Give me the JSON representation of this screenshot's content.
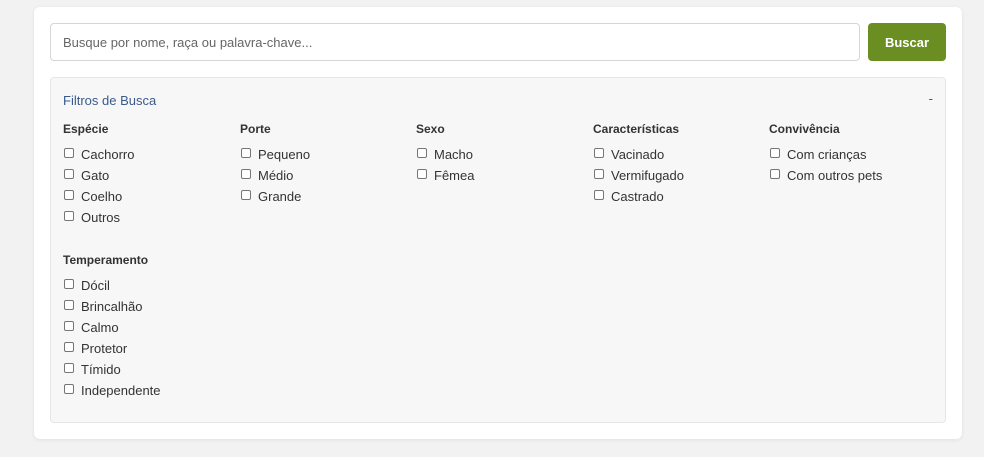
{
  "search": {
    "placeholder": "Busque por nome, raça ou palavra-chave...",
    "value": "",
    "button_label": "Buscar"
  },
  "filters": {
    "title": "Filtros de Busca",
    "toggle": "-",
    "groups": [
      {
        "title": "Espécie",
        "options": [
          "Cachorro",
          "Gato",
          "Coelho",
          "Outros"
        ]
      },
      {
        "title": "Porte",
        "options": [
          "Pequeno",
          "Médio",
          "Grande"
        ]
      },
      {
        "title": "Sexo",
        "options": [
          "Macho",
          "Fêmea"
        ]
      },
      {
        "title": "Características",
        "options": [
          "Vacinado",
          "Vermifugado",
          "Castrado"
        ]
      },
      {
        "title": "Convivência",
        "options": [
          "Com crianças",
          "Com outros pets"
        ]
      },
      {
        "title": "Temperamento",
        "options": [
          "Dócil",
          "Brincalhão",
          "Calmo",
          "Protetor",
          "Tímido",
          "Independente"
        ]
      }
    ]
  },
  "colors": {
    "accent": "#6b8e23",
    "filters_title": "#3a5a8c"
  }
}
